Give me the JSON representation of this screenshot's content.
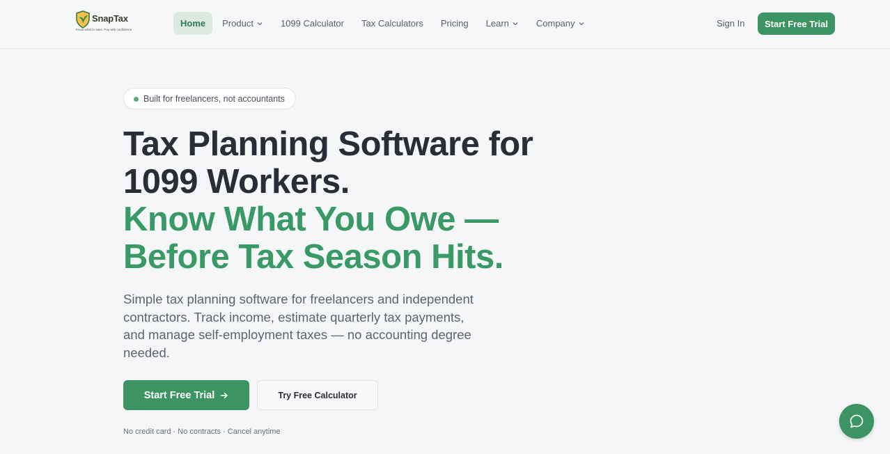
{
  "brand": {
    "name": "SnapTax",
    "tagline": "Know what to save. Pay with confidence",
    "logo_icon": "shield-leaf-icon"
  },
  "nav": {
    "items": [
      {
        "label": "Home",
        "active": true
      },
      {
        "label": "Product",
        "dropdown": true
      },
      {
        "label": "1099 Calculator"
      },
      {
        "label": "Tax Calculators"
      },
      {
        "label": "Pricing"
      },
      {
        "label": "Learn",
        "dropdown": true
      },
      {
        "label": "Company",
        "dropdown": true
      }
    ],
    "sign_in": "Sign In",
    "cta": "Start Free Trial"
  },
  "hero": {
    "badge": "Built for freelancers, not accountants",
    "title_line1": "Tax Planning Software for",
    "title_line2": "1099 Workers.",
    "highlight_line1": "Know What You Owe —",
    "highlight_line2": "Before Tax Season Hits.",
    "subtitle": "Simple tax planning software for freelancers and independent contractors. Track income, estimate quarterly tax payments, and manage self-employment taxes — no accounting degree needed.",
    "primary_cta": "Start Free Trial",
    "secondary_cta": "Try Free Calculator",
    "note": "No credit card · No contracts · Cancel anytime"
  },
  "chat": {
    "icon": "chat-bubble-icon"
  },
  "colors": {
    "accent": "#3c9463",
    "highlight_text": "#3a9a66",
    "heading_text": "#2a2d36",
    "background": "#f5f6f8"
  }
}
